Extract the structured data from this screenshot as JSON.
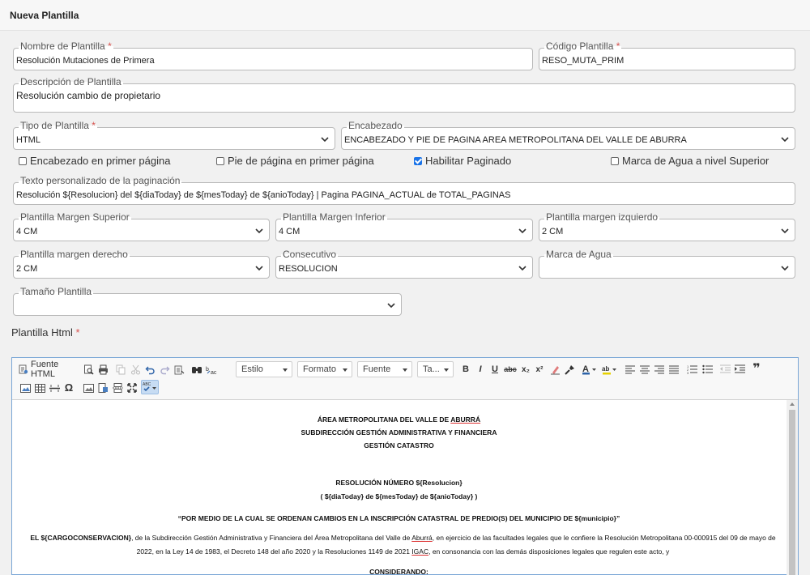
{
  "header": {
    "title": "Nueva Plantilla"
  },
  "form": {
    "nombre": {
      "label": "Nombre de Plantilla",
      "value": "Resolución Mutaciones de Primera"
    },
    "codigo": {
      "label": "Código Plantilla",
      "value": "RESO_MUTA_PRIM"
    },
    "descripcion": {
      "label": "Descripción de Plantilla",
      "value": "Resolución cambio de propietario"
    },
    "tipo": {
      "label": "Tipo de Plantilla",
      "value": "HTML"
    },
    "encabezado": {
      "label": "Encabezado",
      "value": "ENCABEZADO Y PIE DE PAGINA AREA METROPOLITANA DEL VALLE DE ABURRA"
    },
    "checkboxes": [
      {
        "label": "Encabezado en primer página",
        "checked": false
      },
      {
        "label": "Pie de página en primer página",
        "checked": false
      },
      {
        "label": "Habilitar Paginado",
        "checked": true
      },
      {
        "label": "Marca de Agua a nivel Superior",
        "checked": false
      }
    ],
    "paginacion": {
      "label": "Texto personalizado de la paginación",
      "value": "Resolución ${Resolucion} del ${diaToday} de ${mesToday} de ${anioToday} | Pagina PAGINA_ACTUAL de TOTAL_PAGINAS"
    },
    "margen_superior": {
      "label": "Plantilla Margen Superior",
      "value": "4 CM"
    },
    "margen_inferior": {
      "label": "Plantilla Margen Inferior",
      "value": "4 CM"
    },
    "margen_izquierdo": {
      "label": "Plantilla margen izquierdo",
      "value": "2 CM"
    },
    "margen_derecho": {
      "label": "Plantilla margen derecho",
      "value": "2 CM"
    },
    "consecutivo": {
      "label": "Consecutivo",
      "value": "RESOLUCION"
    },
    "marca_agua": {
      "label": "Marca de Agua",
      "value": ""
    },
    "tamano": {
      "label": "Tamaño Plantilla",
      "value": ""
    },
    "required_mark": "*"
  },
  "editor": {
    "label": "Plantilla Html",
    "toolbar": {
      "source_label": "Fuente HTML",
      "estilo": "Estilo",
      "formato": "Formato",
      "fuente": "Fuente",
      "tamano": "Ta...",
      "bold": "B",
      "italic": "I",
      "underline": "U",
      "strike": "abc",
      "subscript": "x₂",
      "superscript": "x²",
      "quote": "❞",
      "omega": "Ω"
    },
    "content": {
      "line1_a": "ÁREA METROPOLITANA DEL VALLE DE ",
      "line1_b": "ABURRÁ",
      "line2": "SUBDIRECCIÓN GESTIÓN ADMINISTRATIVA Y FINANCIERA",
      "line3": "GESTIÓN CATASTRO",
      "line4": "RESOLUCIÓN NÚMERO ${Resolucion}",
      "line5": "( ${diaToday} de ${mesToday} de ${anioToday} )",
      "line6": "“POR MEDIO DE LA CUAL SE ORDENAN CAMBIOS EN LA INSCRIPCIÓN CATASTRAL DE PREDIO(S) DEL MUNICIPIO DE ${municipio}”",
      "para1_bold": "EL ${CARGOCONSERVACION}",
      "para1_a": ", de la Subdirección Gestión Administrativa y Financiera del Área Metropolitana del Valle de ",
      "para1_spell": "Aburrá",
      "para1_b": ", en ejercicio de las facultades legales que le confiere la Resolución Metropolitana 00-000915 del 09 de mayo de",
      "para2_a": "2022, en la Ley 14 de 1983, el Decreto 148 del año 2020 y la Resoluciones 1149 de 2021 ",
      "para2_spell": "IGAC",
      "para2_b": ", en consonancia con las demás disposiciones legales que regulen este acto, y",
      "considerando": "CONSIDERANDO:"
    }
  }
}
